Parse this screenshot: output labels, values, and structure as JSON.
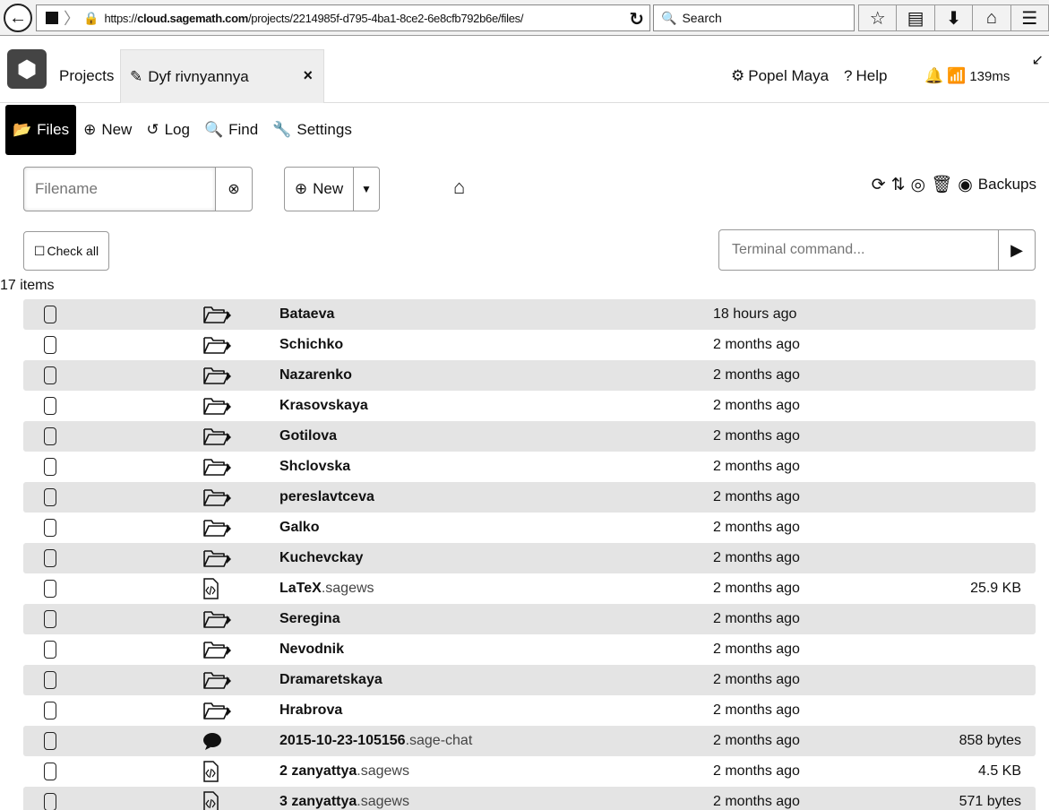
{
  "browser": {
    "url_prefix": "https://",
    "url_host": "cloud.sagemath.com",
    "url_path": "/projects/2214985f-d795-4ba1-8ce2-6e8cfb792b6e/files/",
    "search_placeholder": "Search"
  },
  "topbar": {
    "projects_label": "Projects",
    "project_tab_label": "Dyf rivnyannya",
    "user_label": "Popel Maya",
    "help_label": "Help",
    "latency": "139ms"
  },
  "file_tabs": [
    {
      "label": "Files",
      "icon": "folder-open-icon"
    },
    {
      "label": "New",
      "icon": "plus-circle-icon"
    },
    {
      "label": "Log",
      "icon": "history-icon"
    },
    {
      "label": "Find",
      "icon": "search-icon"
    },
    {
      "label": "Settings",
      "icon": "wrench-icon"
    }
  ],
  "controls": {
    "filename_placeholder": "Filename",
    "new_label": "New",
    "backups_label": "Backups",
    "check_all_label": "Check all",
    "terminal_placeholder": "Terminal command...",
    "item_count": "17 items"
  },
  "files": [
    {
      "name": "Bataeva",
      "ext": "",
      "type": "folder",
      "time": "18 hours ago",
      "size": ""
    },
    {
      "name": "Schichko",
      "ext": "",
      "type": "folder",
      "time": "2 months ago",
      "size": ""
    },
    {
      "name": "Nazarenko",
      "ext": "",
      "type": "folder",
      "time": "2 months ago",
      "size": ""
    },
    {
      "name": "Krasovskaya",
      "ext": "",
      "type": "folder",
      "time": "2 months ago",
      "size": ""
    },
    {
      "name": "Gotilova",
      "ext": "",
      "type": "folder",
      "time": "2 months ago",
      "size": ""
    },
    {
      "name": "Shclovska",
      "ext": "",
      "type": "folder",
      "time": "2 months ago",
      "size": ""
    },
    {
      "name": "pereslavtceva",
      "ext": "",
      "type": "folder",
      "time": "2 months ago",
      "size": ""
    },
    {
      "name": "Galko",
      "ext": "",
      "type": "folder",
      "time": "2 months ago",
      "size": ""
    },
    {
      "name": "Kuchevckay",
      "ext": "",
      "type": "folder",
      "time": "2 months ago",
      "size": ""
    },
    {
      "name": "LaTeX",
      "ext": ".sagews",
      "type": "sagews",
      "time": "2 months ago",
      "size": "25.9 KB"
    },
    {
      "name": "Seregina",
      "ext": "",
      "type": "folder",
      "time": "2 months ago",
      "size": ""
    },
    {
      "name": "Nevodnik",
      "ext": "",
      "type": "folder",
      "time": "2 months ago",
      "size": ""
    },
    {
      "name": "Dramaretskaya",
      "ext": "",
      "type": "folder",
      "time": "2 months ago",
      "size": ""
    },
    {
      "name": "Hrabrova",
      "ext": "",
      "type": "folder",
      "time": "2 months ago",
      "size": ""
    },
    {
      "name": "2015-10-23-105156",
      "ext": ".sage-chat",
      "type": "chat",
      "time": "2 months ago",
      "size": "858 bytes"
    },
    {
      "name": "2 zanyattya",
      "ext": ".sagews",
      "type": "sagews",
      "time": "2 months ago",
      "size": "4.5 KB"
    },
    {
      "name": "3 zanyattya",
      "ext": ".sagews",
      "type": "sagews",
      "time": "2 months ago",
      "size": "571 bytes"
    }
  ]
}
